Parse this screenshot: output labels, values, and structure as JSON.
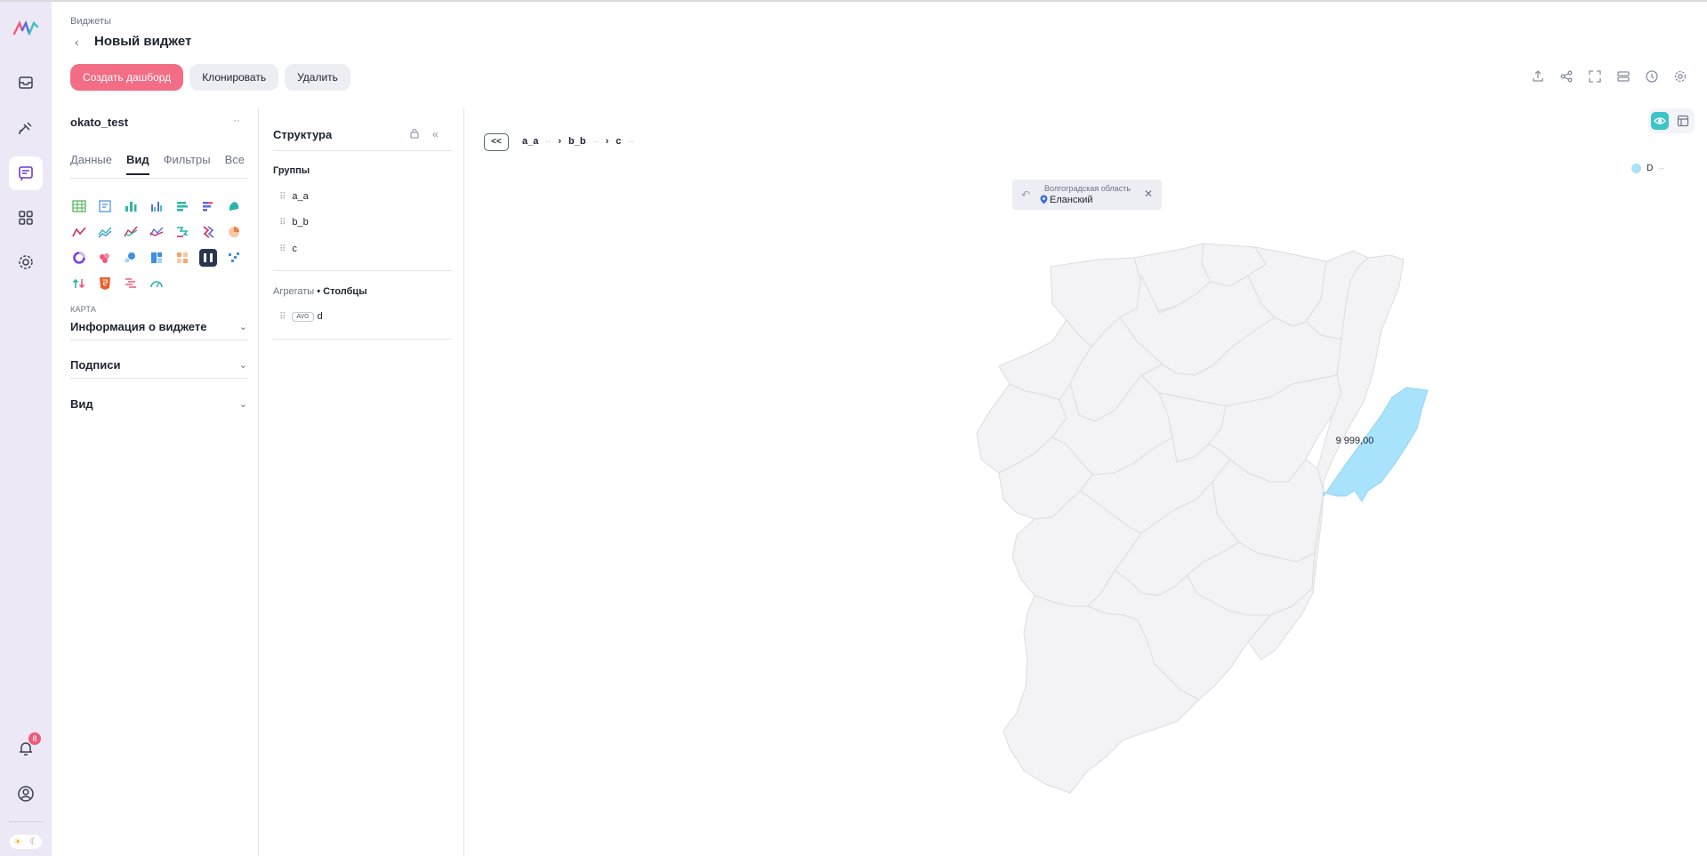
{
  "header": {
    "breadcrumb": "Виджеты",
    "title": "Новый виджет",
    "create_dashboard": "Создать дашборд",
    "clone": "Клонировать",
    "delete": "Удалить"
  },
  "sidebar": {
    "notifications_count": "8",
    "icons": [
      "logo-icon",
      "inbox-icon",
      "satellite-icon",
      "widgets-icon",
      "apps-grid-icon",
      "gear-icon",
      "bell-icon",
      "user-icon",
      "sun-icon",
      "moon-icon"
    ]
  },
  "settings": {
    "dataset": "okato_test",
    "more": "··",
    "tabs": [
      "Данные",
      "Вид",
      "Фильтры",
      "Все"
    ],
    "active_tab": "Вид",
    "chart_type_label": "КАРТА",
    "accordions": [
      "Информация о виджете",
      "Подписи",
      "Вид"
    ]
  },
  "structure": {
    "title": "Структура",
    "groups_title": "Группы",
    "groups": [
      "a_a",
      "b_b",
      "c"
    ],
    "aggregates_label": "Агрегаты",
    "columns_label": "• Столбцы",
    "aggregates": [
      {
        "func": "AVG",
        "field": "d"
      }
    ]
  },
  "chart": {
    "drill_back": "<<",
    "drill_path": [
      "a_a",
      "b_b",
      "c"
    ],
    "drill_dots": "··",
    "legend_label": "D",
    "legend_more": "··",
    "tooltip_region": "Волгоградская область",
    "tooltip_location": "Еланский",
    "highlight_value": "9 999,00",
    "highlight_color": "#a8e2fb",
    "base_color": "#f3f3f5",
    "accent": "#f26d85"
  }
}
